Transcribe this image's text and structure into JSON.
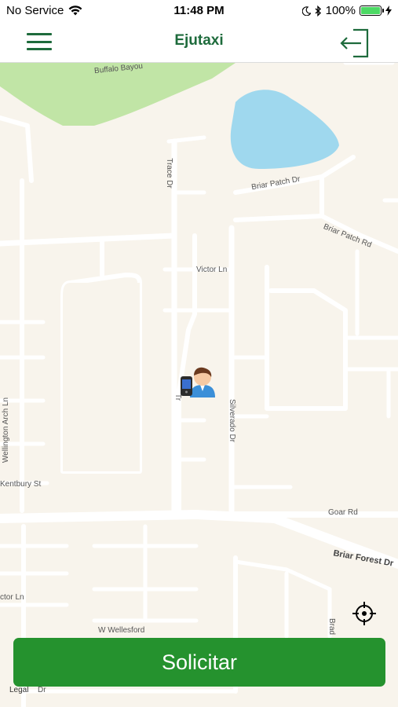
{
  "status_bar": {
    "carrier": "No Service",
    "time": "11:48 PM",
    "battery": "100%",
    "battery_level": 1.0
  },
  "nav": {
    "title": "Ejutaxi",
    "menu_icon": "hamburger-menu-icon",
    "logout_icon": "logout-icon",
    "accent_color": "#1e6b3c"
  },
  "map": {
    "labels": {
      "buffalo_bayou": "Buffalo Bayou",
      "briar_patch_dr": "Briar Patch Dr",
      "trace_dr": "Trace Dr",
      "briar_patch_rd": "Briar Patch Rd",
      "victor_ln": "Victor Ln",
      "wellington_arch_ln": "Wellington Arch Ln",
      "silverado_dr": "Silverado Dr",
      "kentbury_st": "Kentbury St",
      "goar_rd": "Goar Rd",
      "briar_forest_dr": "Briar Forest Dr",
      "victor_ln_2": "ctor Ln",
      "w_wellesford": "W Wellesford",
      "brad": "Brad",
      "legal": "Legal",
      "trace_partial": "Tr",
      "bottom_dr": "Dr"
    },
    "user_marker_icon": "user-location-icon",
    "locate_icon": "crosshair-icon"
  },
  "actions": {
    "request_label": "Solicitar",
    "request_color": "#25922e"
  }
}
